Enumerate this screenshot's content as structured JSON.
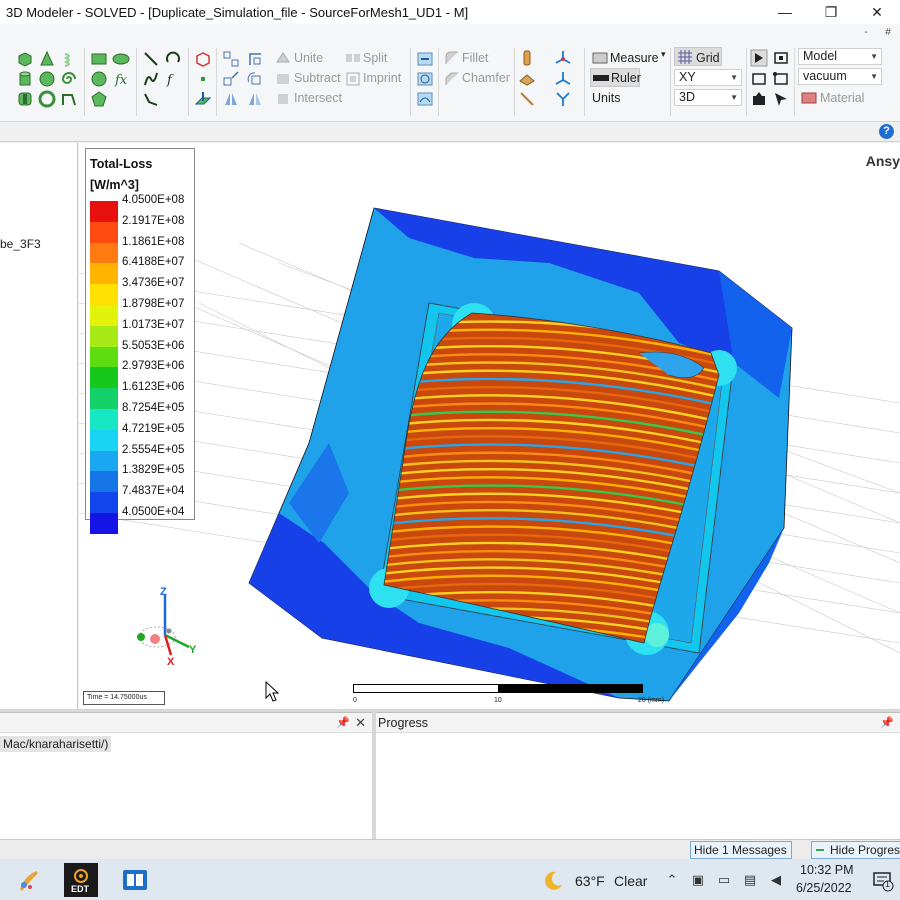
{
  "window": {
    "title": "3D Modeler - SOLVED - [Duplicate_Simulation_file - SourceForMesh1_UD1 - M]",
    "minimize": "—",
    "restore": "❐",
    "close": "✕",
    "ribbon_minimize": "-",
    "ribbon_pin": "#"
  },
  "ribbon": {
    "boolean": {
      "unite": "Unite",
      "subtract": "Subtract",
      "intersect": "Intersect",
      "split": "Split",
      "imprint": "Imprint"
    },
    "edges": {
      "fillet": "Fillet",
      "chamfer": "Chamfer"
    },
    "measure": {
      "measure": "Measure",
      "ruler": "Ruler",
      "units": "Units"
    },
    "grid": {
      "grid": "Grid",
      "plane": "XY",
      "mode": "3D"
    },
    "material": {
      "view": "Model",
      "material_value": "vacuum",
      "material": "Material"
    }
  },
  "tree": {
    "items": [
      "be_3F3"
    ]
  },
  "viewport": {
    "brand": "Ansy"
  },
  "legend": {
    "title": "Total-Loss",
    "unit": "[W/m^3]",
    "values": [
      "4.0500E+08",
      "2.1917E+08",
      "1.1861E+08",
      "6.4188E+07",
      "3.4736E+07",
      "1.8798E+07",
      "1.0173E+07",
      "5.5053E+06",
      "2.9793E+06",
      "1.6123E+06",
      "8.7254E+05",
      "4.7219E+05",
      "2.5554E+05",
      "1.3829E+05",
      "7.4837E+04",
      "4.0500E+04"
    ],
    "colors": [
      "#e8100c",
      "#ff4a10",
      "#ff7a12",
      "#ffb400",
      "#ffe000",
      "#e2f20a",
      "#a8ea18",
      "#5ddc12",
      "#16c81a",
      "#14d068",
      "#16e6c2",
      "#1ad2f2",
      "#1aa6f0",
      "#1676e8",
      "#1446ee",
      "#1414e6"
    ]
  },
  "time": {
    "text": "Time = 14.75000us"
  },
  "scale": {
    "ticks": [
      "0",
      "10",
      "20 (mm)"
    ]
  },
  "triad": {
    "z": "Z",
    "y": "Y",
    "x": "X"
  },
  "messages": {
    "title": "",
    "line": "Mac/knaraharisetti/)"
  },
  "progress": {
    "title": "Progress"
  },
  "statusbar": {
    "hide_messages": "Hide 1 Messages",
    "hide_progress": "Hide Progress"
  },
  "taskbar": {
    "weather_temp": "63°F",
    "weather_desc": "Clear",
    "time": "10:32 PM",
    "date": "6/25/2022",
    "notifications": "1",
    "app_label": "EDT"
  }
}
